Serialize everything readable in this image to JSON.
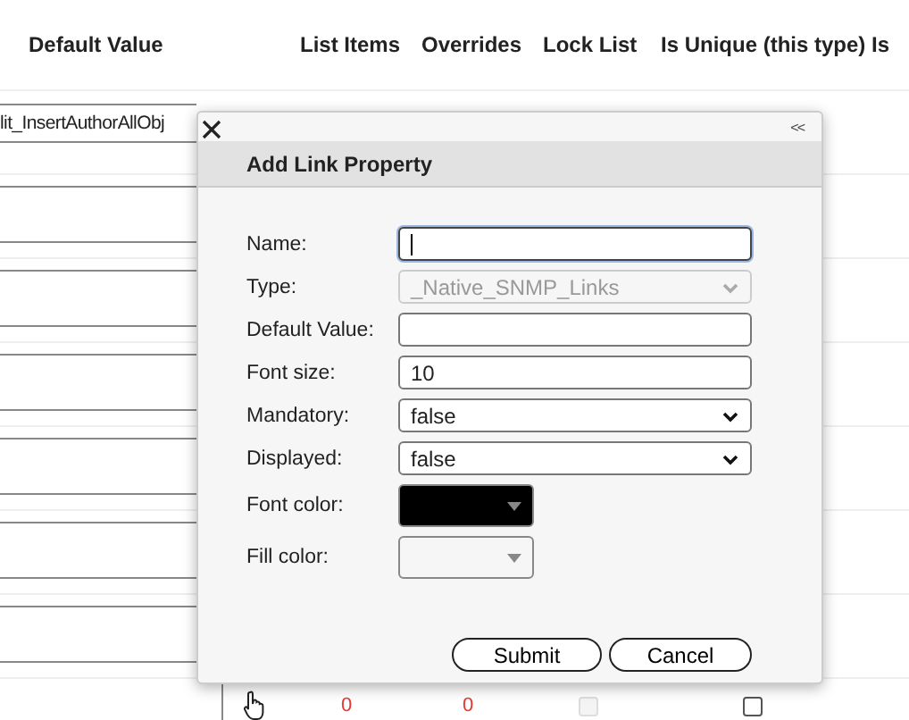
{
  "table": {
    "columns": [
      "Default Value",
      "List Items",
      "Overrides",
      "Lock List",
      "Is Unique (this type)",
      "Is"
    ],
    "first_row": {
      "default_value": "lit_InsertAuthorAllObj"
    },
    "last_row": {
      "list_items": "0",
      "overrides": "0",
      "lock_list": {
        "checked": false,
        "disabled": true
      },
      "is_unique": {
        "checked": false,
        "disabled": false
      }
    }
  },
  "dialog": {
    "title": "Add Link Property",
    "collapse": "<<",
    "fields": [
      {
        "label": "Name:",
        "kind": "text",
        "focused": true
      },
      {
        "label": "Type:",
        "kind": "select",
        "value": "_Native_SNMP_Links",
        "disabled": true
      },
      {
        "label": "Default Value:",
        "kind": "text",
        "focused": false
      },
      {
        "label": "Font size:",
        "kind": "text",
        "value": "10",
        "focused": false
      },
      {
        "label": "Mandatory:",
        "kind": "select",
        "value": "false",
        "disabled": false
      },
      {
        "label": "Displayed:",
        "kind": "select",
        "value": "false",
        "disabled": false
      },
      {
        "label": "Font color:",
        "kind": "color",
        "color": "#000000"
      },
      {
        "label": "Fill color:",
        "kind": "color"
      }
    ],
    "buttons": [
      "Submit",
      "Cancel"
    ]
  }
}
